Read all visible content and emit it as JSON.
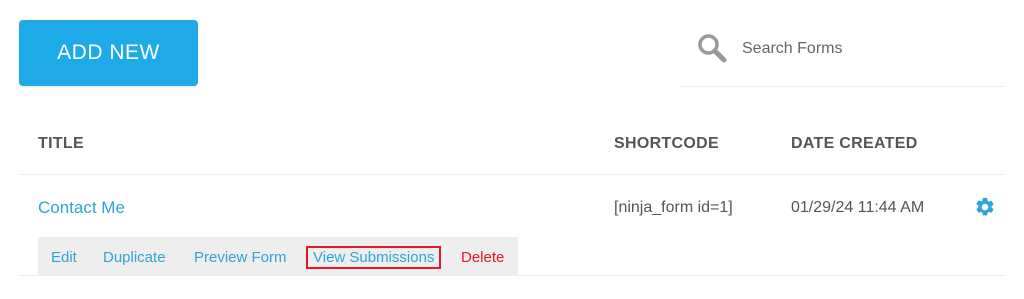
{
  "toolbar": {
    "add_new_label": "ADD NEW"
  },
  "search": {
    "placeholder": "Search Forms",
    "value": ""
  },
  "table": {
    "columns": {
      "title": "TITLE",
      "shortcode": "SHORTCODE",
      "date_created": "DATE CREATED"
    },
    "rows": [
      {
        "title": "Contact Me",
        "shortcode": "[ninja_form id=1]",
        "date_created": "01/29/24 11:44 AM",
        "actions": {
          "edit": "Edit",
          "duplicate": "Duplicate",
          "preview": "Preview Form",
          "view_submissions": "View Submissions",
          "delete": "Delete"
        }
      }
    ]
  },
  "icons": {
    "search": "search-icon",
    "settings": "gear-icon"
  },
  "colors": {
    "accent": "#1ea9e8",
    "link": "#2da5d9",
    "danger": "#e4172b",
    "highlight_border": "#e4172b"
  }
}
